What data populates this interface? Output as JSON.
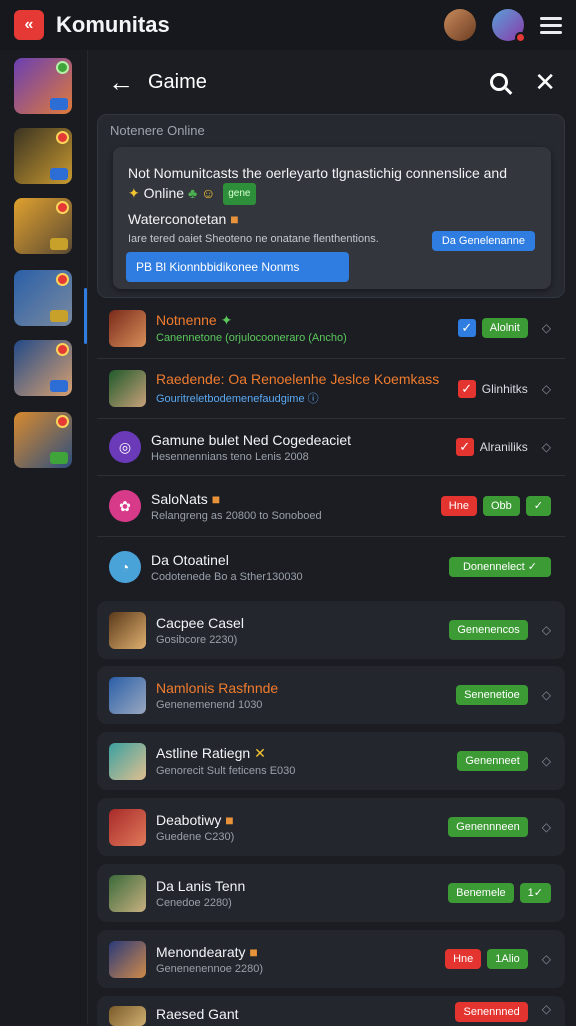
{
  "app": {
    "title": "Komunitas"
  },
  "panel": {
    "title": "Gaime"
  },
  "online": {
    "label": "Notenere Online",
    "notice_text": "Not Nomunitcasts the oerleyarto tlgnastichig connenslice and",
    "notice_line2": "Online",
    "notice_tag": "gene",
    "notice_sub": "Waterconotetan",
    "notice_small": "Iare tered oaiet Sheoteno ne onatane flenthentions.",
    "notice_btn_right": "Da Genelenanne",
    "notice_btn": "PB Bl Kionnbbidikonee Nonms"
  },
  "rows": [
    {
      "name": "Notnenne",
      "sub": "Canennetone (orjulocooneraro (Ancho)",
      "right": [
        "Alolnit"
      ]
    },
    {
      "name": "Raedende: Oa Renoelenhe Jeslce Koemkass",
      "sub": "Gouritreletbodemenefaudgime",
      "right": [
        "Glinhitks"
      ]
    },
    {
      "name": "Gamune bulet Ned Cogedeaciet",
      "sub": "Hesennennians teno Lenis 2008",
      "right": [
        "Alraniliks"
      ]
    },
    {
      "name": "SaloNats",
      "sub": "Relangreng as 20800 to Sonoboed",
      "right": [
        "Hne",
        "Obb",
        "✓"
      ]
    },
    {
      "name": "Da Otoatinel",
      "sub": "Codotenede Bo a Sther130030",
      "right": [
        "Donennelect ✓"
      ]
    },
    {
      "name": "Cacpee Casel",
      "sub": "Gosibcore 2230)",
      "right": [
        "Genenencos"
      ]
    },
    {
      "name": "Namlonis Rasfnnde",
      "sub": "Genenemenend 1030",
      "right": [
        "Senenetioe"
      ]
    },
    {
      "name": "Astline Ratiegn",
      "sub": "Genorecit Sult feticens E030",
      "right": [
        "Genenneet"
      ]
    },
    {
      "name": "Deabotiwy",
      "sub": "Guedene C230)",
      "right": [
        "Genennneen"
      ]
    },
    {
      "name": "Da Lanis Tenn",
      "sub": "Cenedoe 2280)",
      "right": [
        "Benemele",
        "1✓"
      ]
    },
    {
      "name": "Menondearaty",
      "sub": "Genenenennoe 2280)",
      "right": [
        "Hne",
        "1Alio"
      ]
    },
    {
      "name": "Raesed Gant",
      "sub": "",
      "right": [
        "Senennned"
      ]
    }
  ]
}
